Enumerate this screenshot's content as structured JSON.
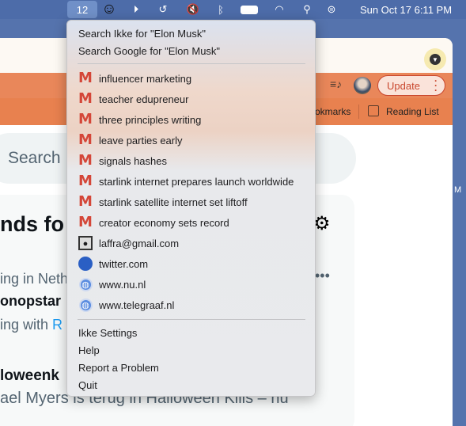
{
  "menubar": {
    "badge": "12",
    "clock": "Sun Oct 17  6:11 PM",
    "icons": [
      "smiley-icon",
      "play-icon",
      "time-machine-icon",
      "mute-icon",
      "bluetooth-icon",
      "battery-icon",
      "wifi-icon",
      "spotlight-icon",
      "control-center-icon"
    ]
  },
  "browser": {
    "update_label": "Update",
    "bookmarks_label": "okmarks",
    "reading_list_label": "Reading List"
  },
  "page": {
    "search": "Search",
    "heading": "nds fo",
    "line1": "ing in Neth",
    "line2": "onopstar",
    "line3a": "ing with ",
    "line3b": "R",
    "heading2": "loweenk",
    "line4": "ael Myers is terug in Halloween Kills – nu",
    "edge_letter": "M"
  },
  "menu": {
    "search_items": [
      "Search Ikke for \"Elon Musk\"",
      "Search Google for \"Elon Musk\""
    ],
    "results": [
      {
        "icon": "gmail-icon",
        "label": "influencer marketing"
      },
      {
        "icon": "gmail-icon",
        "label": "teacher edupreneur"
      },
      {
        "icon": "gmail-icon",
        "label": "three principles writing"
      },
      {
        "icon": "gmail-icon",
        "label": "leave parties early"
      },
      {
        "icon": "gmail-icon",
        "label": "signals hashes"
      },
      {
        "icon": "gmail-icon",
        "label": "starlink internet prepares launch worldwide"
      },
      {
        "icon": "gmail-icon",
        "label": "starlink satellite internet set liftoff"
      },
      {
        "icon": "gmail-icon",
        "label": "creator economy sets record"
      },
      {
        "icon": "contact-icon",
        "label": "laffra@gmail.com"
      },
      {
        "icon": "twitter-icon",
        "label": "twitter.com"
      },
      {
        "icon": "globe-icon",
        "label": "www.nu.nl"
      },
      {
        "icon": "globe-icon",
        "label": "www.telegraaf.nl"
      }
    ],
    "actions": [
      "Ikke Settings",
      "Help",
      "Report a Problem",
      "Quit"
    ]
  }
}
